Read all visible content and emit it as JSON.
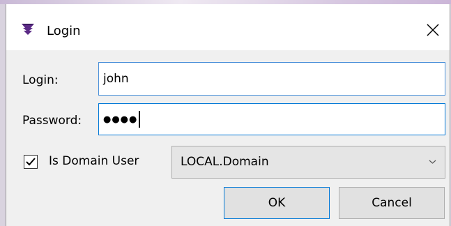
{
  "window": {
    "title": "Login",
    "icon": "app-logo-icon",
    "close_icon": "close-icon"
  },
  "form": {
    "login_label": "Login:",
    "login_value": "john",
    "password_label": "Password:",
    "password_mask": "●●●●",
    "domain_checkbox_label": "Is Domain User",
    "domain_checked": true,
    "domain_selected": "LOCAL.Domain"
  },
  "buttons": {
    "ok_label": "OK",
    "cancel_label": "Cancel"
  },
  "colors": {
    "focus_border": "#0078d7",
    "input_border": "#4a90d9",
    "logo": "#5b2a86"
  }
}
